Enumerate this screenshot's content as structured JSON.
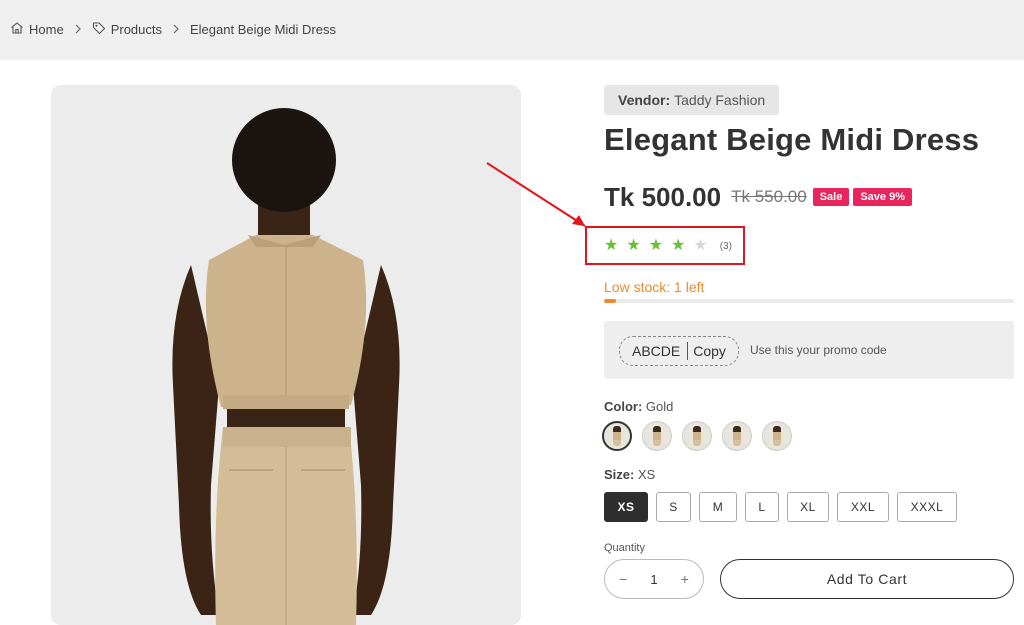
{
  "breadcrumb": {
    "home": "Home",
    "products": "Products",
    "current": "Elegant Beige Midi Dress"
  },
  "product": {
    "vendor_label": "Vendor:",
    "vendor_name": "Taddy Fashion",
    "title": "Elegant Beige Midi Dress",
    "price": "Tk 500.00",
    "compare_price": "Tk 550.00",
    "badge_sale": "Sale",
    "badge_save": "Save 9%",
    "rating": 4,
    "rating_max": 5,
    "rating_count": "(3)",
    "stock_text": "Low stock: 1 left",
    "stock_level": 0.03,
    "image_icon": "back-view-model-photo"
  },
  "promo": {
    "code": "ABCDE",
    "copy_label": "Copy",
    "text": "Use this your promo code"
  },
  "color": {
    "label": "Color:",
    "selected": "Gold",
    "swatch_count": 5
  },
  "size": {
    "label": "Size:",
    "selected": "XS",
    "options": [
      "XS",
      "S",
      "M",
      "L",
      "XL",
      "XXL",
      "XXXL"
    ]
  },
  "quantity": {
    "label": "Quantity",
    "value": "1",
    "minus": "−",
    "plus": "+"
  },
  "cart": {
    "add_label": "Add To Cart"
  },
  "colors": {
    "accent_green": "#6abf3a",
    "sale_pink": "#e8255c",
    "stock_orange": "#ef8a2c",
    "highlight_red": "#e3161d"
  }
}
